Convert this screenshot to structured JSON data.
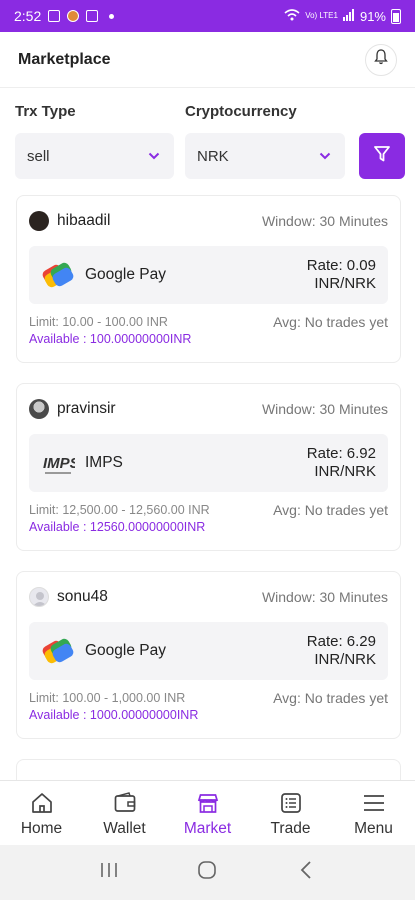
{
  "status_bar": {
    "time": "2:52",
    "signal_text": "Vo) LTE1",
    "battery": "91%"
  },
  "header": {
    "title": "Marketplace",
    "bell_icon": "bell-icon"
  },
  "filters": {
    "trx_type_label": "Trx Type",
    "trx_type_value": "sell",
    "crypto_label": "Cryptocurrency",
    "crypto_value": "NRK",
    "filter_icon": "filter-icon",
    "accent": "#8a2be2"
  },
  "offers": [
    {
      "username": "hibaadil",
      "window": "Window: 30 Minutes",
      "payment": "Google Pay",
      "payment_icon": "google-pay-icon",
      "rate_line1": "Rate: 0.09",
      "rate_line2": "INR/NRK",
      "limit": "Limit: 10.00 - 100.00 INR",
      "available": "Available : 100.00000000INR",
      "avg": "Avg: No trades yet"
    },
    {
      "username": "pravinsir",
      "window": "Window: 30 Minutes",
      "payment": "IMPS",
      "payment_icon": "imps-icon",
      "rate_line1": "Rate: 6.92",
      "rate_line2": "INR/NRK",
      "limit": "Limit: 12,500.00 - 12,560.00 INR",
      "available": "Available : 12560.00000000INR",
      "avg": "Avg: No trades yet"
    },
    {
      "username": "sonu48",
      "window": "Window: 30 Minutes",
      "payment": "Google Pay",
      "payment_icon": "google-pay-icon",
      "rate_line1": "Rate: 6.29",
      "rate_line2": "INR/NRK",
      "limit": "Limit: 100.00 - 1,000.00 INR",
      "available": "Available : 1000.00000000INR",
      "avg": "Avg: No trades yet"
    }
  ],
  "bottom_nav": [
    {
      "label": "Home",
      "icon": "home-icon"
    },
    {
      "label": "Wallet",
      "icon": "wallet-icon"
    },
    {
      "label": "Market",
      "icon": "market-icon",
      "active": true
    },
    {
      "label": "Trade",
      "icon": "trade-icon"
    },
    {
      "label": "Menu",
      "icon": "menu-icon"
    }
  ]
}
